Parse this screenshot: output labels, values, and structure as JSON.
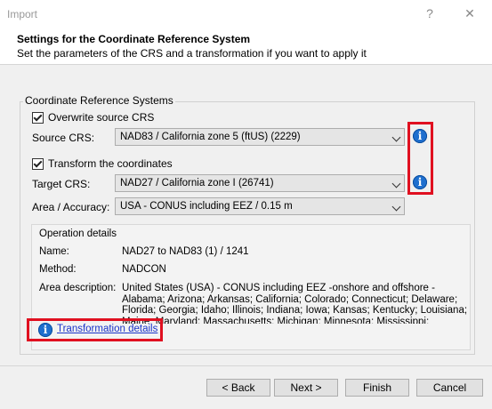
{
  "window": {
    "title": "Import",
    "help_glyph": "?",
    "close_glyph": "✕"
  },
  "header": {
    "title": "Settings for the Coordinate Reference System",
    "subtitle": "Set the parameters of the CRS and a transformation if you want to apply it"
  },
  "crs_group": {
    "legend": "Coordinate Reference Systems",
    "overwrite_label": "Overwrite source CRS",
    "overwrite_checked": true,
    "source_label": "Source CRS:",
    "source_value": "NAD83 / California zone 5 (ftUS) (2229)",
    "transform_label": "Transform the coordinates",
    "transform_checked": true,
    "target_label": "Target CRS:",
    "target_value": "NAD27 / California zone I (26741)",
    "area_label": "Area / Accuracy:",
    "area_value": "USA - CONUS including EEZ / 0.15 m",
    "info_glyph": "i"
  },
  "operation": {
    "legend": "Operation details",
    "name_label": "Name:",
    "name_value": "NAD27 to NAD83 (1) / 1241",
    "method_label": "Method:",
    "method_value": "NADCON",
    "area_label": "Area description:",
    "area_value": "United States (USA) - CONUS including EEZ -onshore and offshore - Alabama; Arizona; Arkansas; California; Colorado; Connecticut; Delaware; Florida; Georgia; Idaho; Illinois; Indiana; Iowa; Kansas; Kentucky; Louisiana; Maine; Maryland; Massachusetts; Michigan; Minnesota; Mississippi; Missouri; Montan...",
    "details_link": "Transformation details"
  },
  "footer": {
    "back": "< Back",
    "next": "Next >",
    "finish": "Finish",
    "cancel": "Cancel"
  },
  "colors": {
    "highlight": "#e01020",
    "info_icon": "#1f6fce",
    "link": "#1a33c8"
  }
}
